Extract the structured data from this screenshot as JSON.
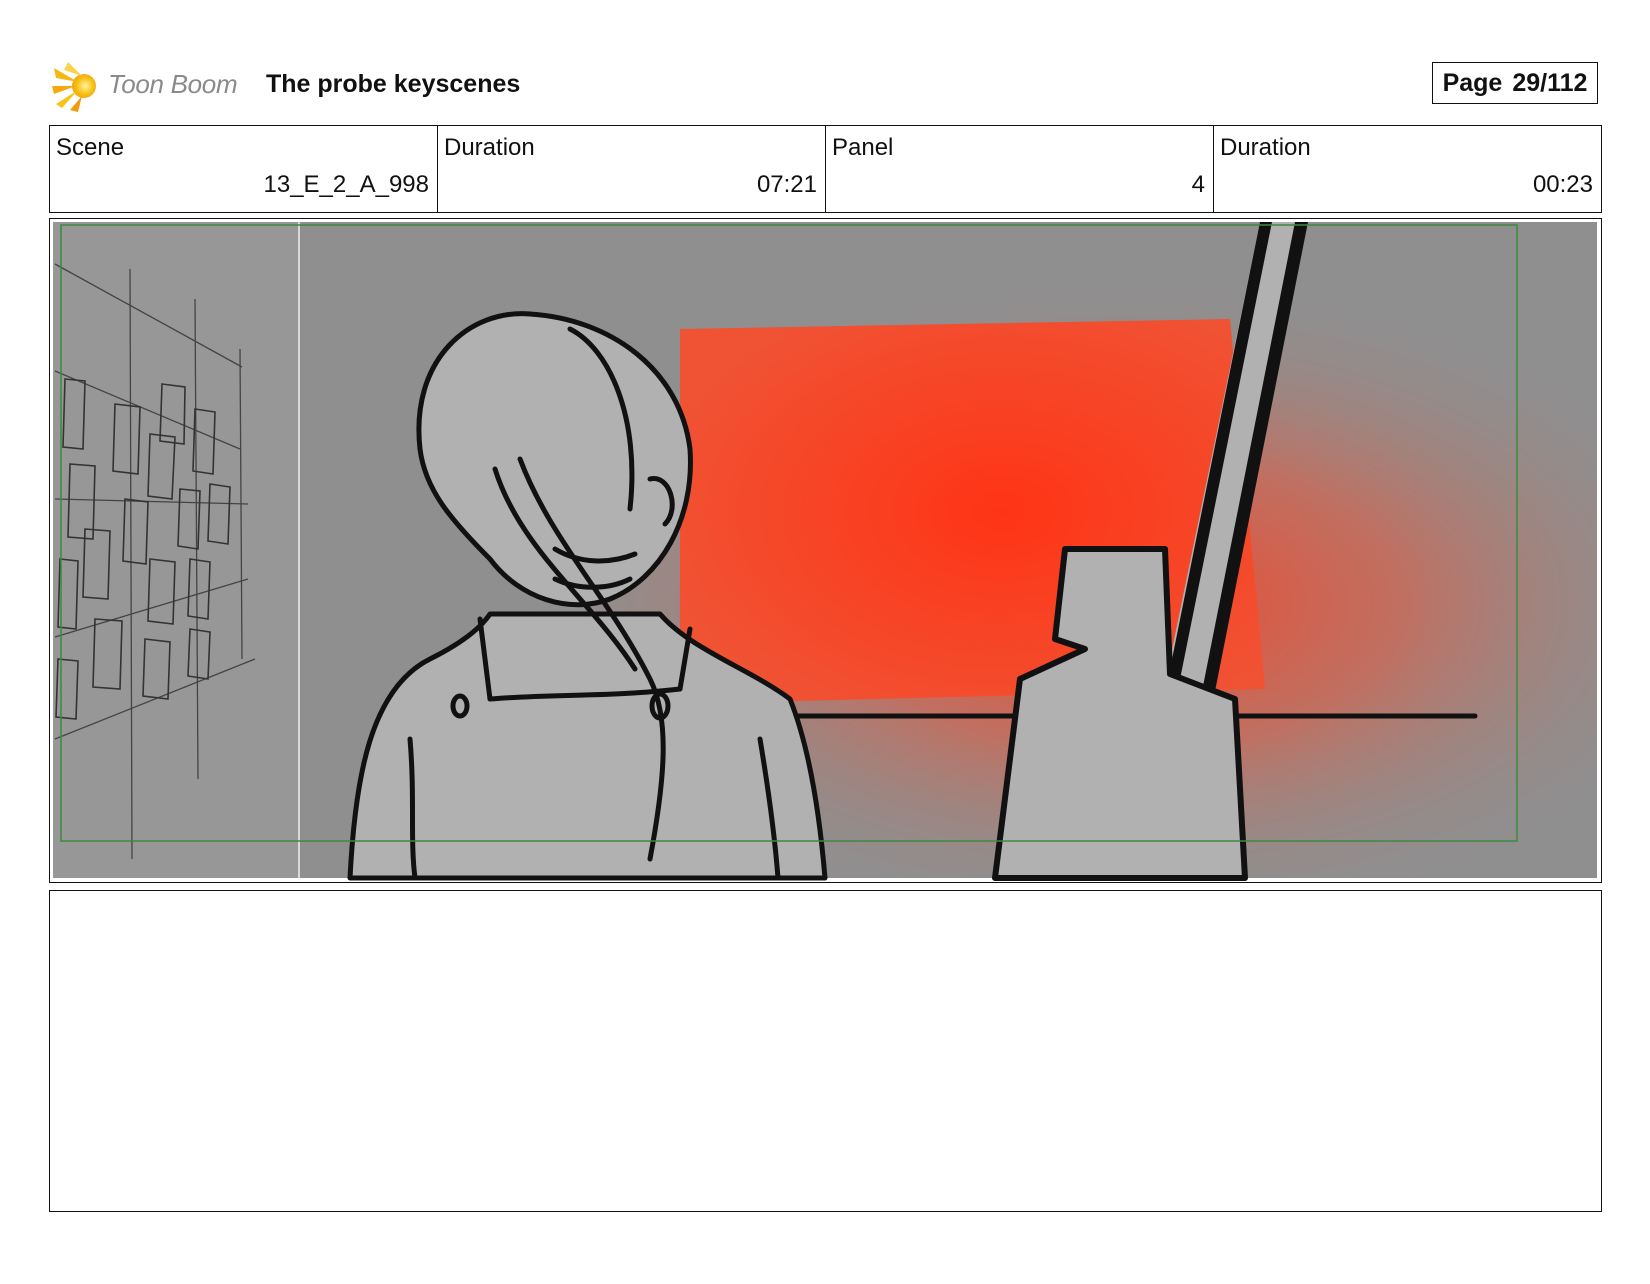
{
  "header": {
    "logo_text": "Toon Boom",
    "logo_icon": "toon-boom-sun-icon",
    "project_title": "The probe keyscenes",
    "page_label": "Page",
    "page_value": "29/112"
  },
  "info": {
    "scene_label": "Scene",
    "scene_value": "13_E_2_A_998",
    "scene_duration_label": "Duration",
    "scene_duration_value": "07:21",
    "panel_label": "Panel",
    "panel_value": "4",
    "panel_duration_label": "Duration",
    "panel_duration_value": "00:23"
  },
  "colors": {
    "background_gray": "#8f8f8f",
    "red_screen": "#f83a1c",
    "safe_frame_green": "#3f8a3f",
    "figure_gray": "#b1b1b1"
  },
  "notes": {
    "text": ""
  }
}
